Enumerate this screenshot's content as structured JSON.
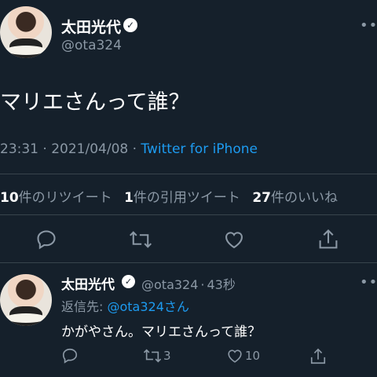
{
  "main_tweet": {
    "author_name": "太田光代",
    "author_handle": "@ota324",
    "text": "マリエさんって誰？",
    "time": "23:31",
    "separator1": " · ",
    "date": "2021/04/08",
    "separator2": " · ",
    "source": "Twitter for iPhone",
    "stats": [
      {
        "count": "10",
        "label": "件のリツイート"
      },
      {
        "count": "1",
        "label": "件の引用ツイート"
      },
      {
        "count": "27",
        "label": "件のいいね"
      }
    ],
    "icons": [
      "reply-icon",
      "retweet-icon",
      "like-icon",
      "share-icon"
    ]
  },
  "reply_tweet": {
    "author_name": "太田光代",
    "author_handle": "@ota324",
    "dot": "·",
    "age": "43秒",
    "reply_to_prefix": "返信先: ",
    "reply_to_mention": "@ota324さん",
    "text": "かがやさん。マリエさんって誰？",
    "retweets": "3",
    "likes": "10"
  },
  "more_menu": "•••",
  "colors": {
    "background": "#15202b",
    "secondary_text": "#8b98a5",
    "link": "#1d9bf0",
    "divider": "#38444d"
  }
}
